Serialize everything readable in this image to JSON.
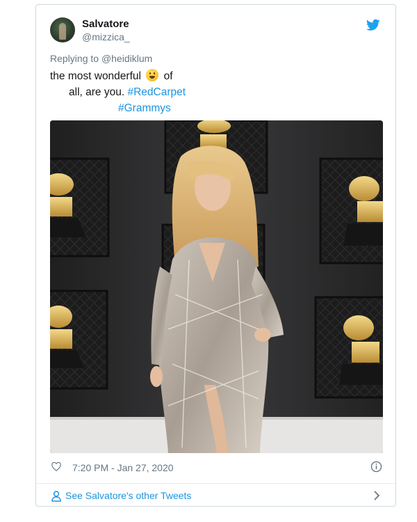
{
  "tweet": {
    "author": {
      "name": "Salvatore",
      "handle": "@mizzica_",
      "avatar_icon": "user-avatar"
    },
    "replying_prefix": "Replying to",
    "replying_handle": "@heidiklum",
    "text_lines": [
      {
        "pre": "the most wonderful",
        "emoji": "grinning-face-emoji",
        "post": "of"
      },
      {
        "pre": "all, are you.",
        "hashtag": "#RedCarpet"
      },
      {
        "hashtag": "#Grammys"
      }
    ],
    "image_alt": "photo",
    "timestamp": "7:20 PM - Jan 27, 2020",
    "footer_link": "See Salvatore's other Tweets"
  },
  "icons": {
    "brand": "twitter-bird-icon",
    "like": "heart-icon",
    "info": "info-icon",
    "profile": "person-icon",
    "more": "chevron-right-icon"
  },
  "colors": {
    "link": "#1b95e0",
    "secondary_text": "#657786",
    "primary_text": "#14171a",
    "border": "#cfd9de"
  }
}
